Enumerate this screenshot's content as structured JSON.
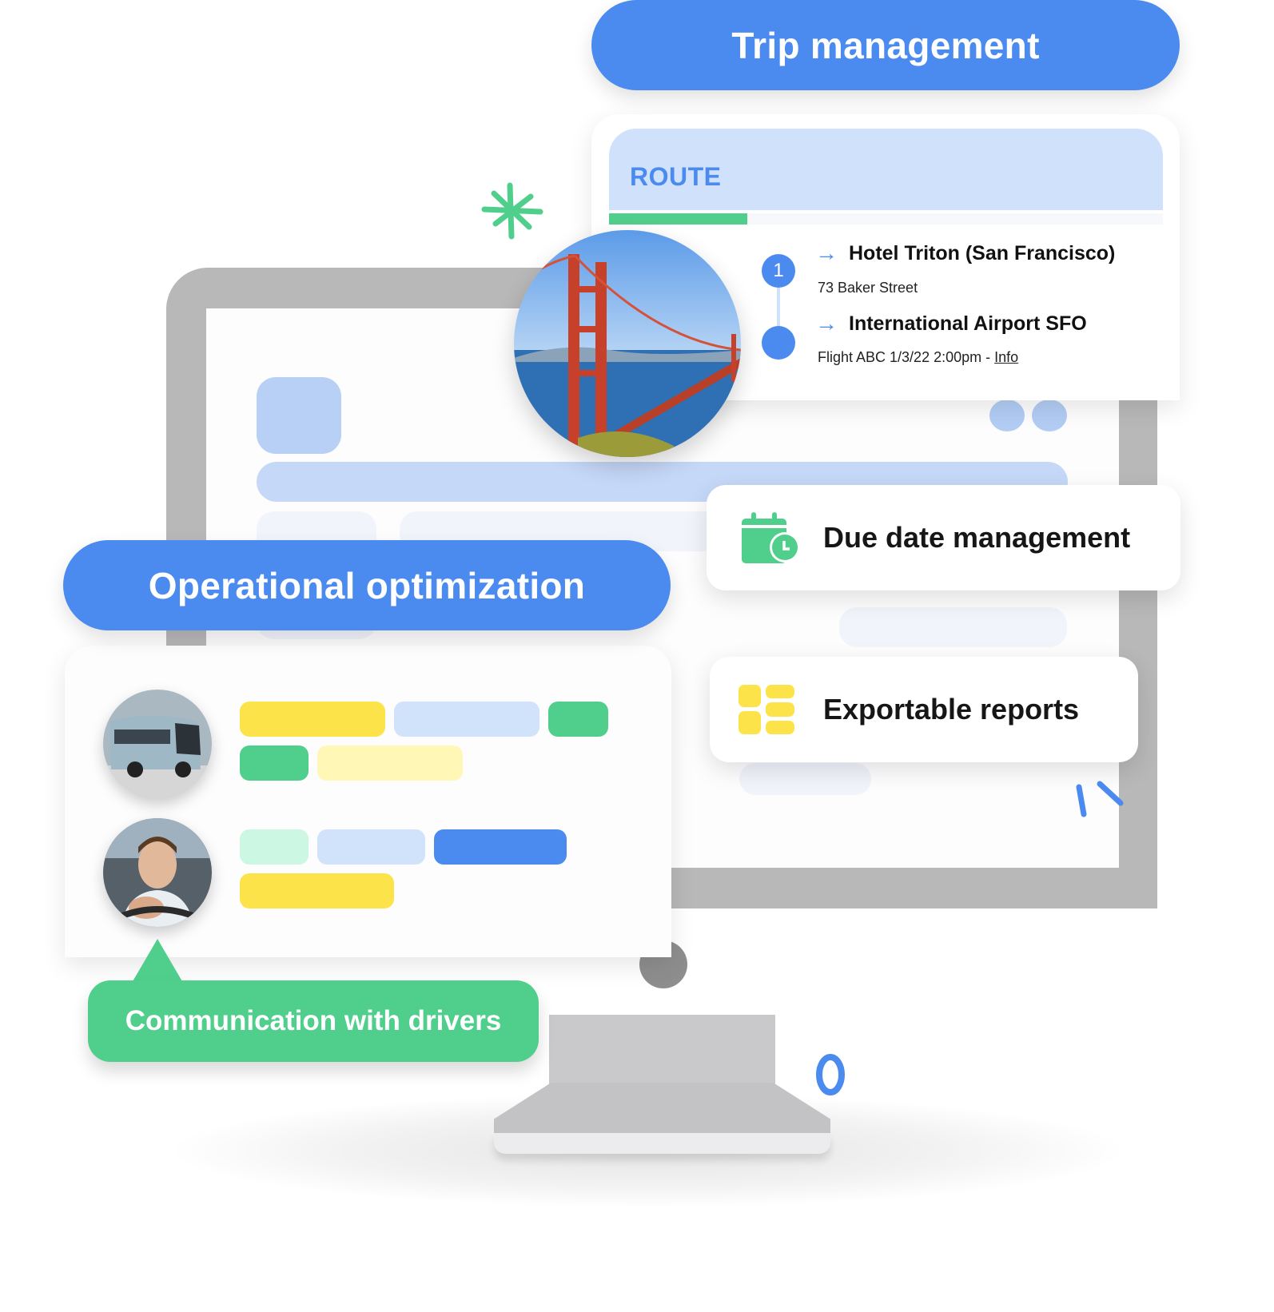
{
  "trip_management": {
    "title": "Trip management",
    "route": {
      "header": "ROUTE",
      "progress_fraction": 0.25,
      "stops": [
        {
          "marker": "1",
          "name": "Hotel Triton (San Francisco)",
          "detail": "73 Baker Street"
        },
        {
          "marker": "",
          "name": "International Airport SFO",
          "detail": "Flight ABC 1/3/22 2:00pm - ",
          "link": "Info"
        }
      ],
      "photo": "golden-gate-bridge-photo"
    }
  },
  "features": {
    "due_date": {
      "label": "Due date management",
      "icon": "calendar-clock-icon"
    },
    "exportable": {
      "label": "Exportable reports",
      "icon": "report-grid-icon"
    }
  },
  "operational": {
    "title": "Operational optimization",
    "rows": [
      {
        "avatar": "bus-photo",
        "chips": [
          [
            "#fde34a",
            "#d1e2fb",
            "#50cf8c"
          ],
          [
            "#50cf8c",
            "#fff7b5"
          ]
        ]
      },
      {
        "avatar": "driver-photo",
        "chips": [
          [
            "#ccf7e2",
            "#d1e2fb",
            "#4b8bef"
          ],
          [
            "#fde34a"
          ]
        ]
      }
    ]
  },
  "communication": {
    "label": "Communication with drivers"
  },
  "colors": {
    "primary_blue": "#4b8bef",
    "green": "#50cf8c",
    "yellow": "#fde34a",
    "light_blue": "#cfe1fb"
  }
}
